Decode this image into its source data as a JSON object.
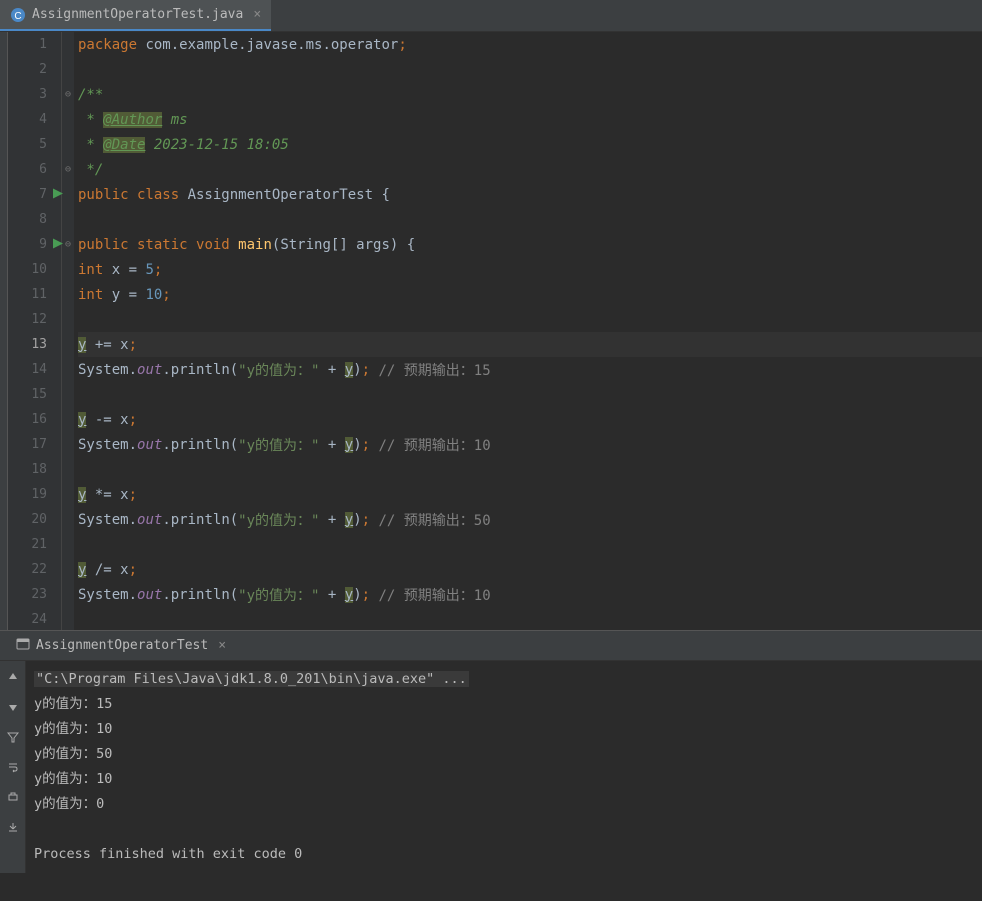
{
  "tab": {
    "name": "AssignmentOperatorTest.java"
  },
  "gutter": {
    "lines": [
      "1",
      "2",
      "3",
      "4",
      "5",
      "6",
      "7",
      "8",
      "9",
      "10",
      "11",
      "12",
      "13",
      "14",
      "15",
      "16",
      "17",
      "18",
      "19",
      "20",
      "21",
      "22",
      "23",
      "24"
    ],
    "currentLine": 13,
    "playLines": [
      7,
      9
    ]
  },
  "code": {
    "l1": {
      "kw1": "package ",
      "pkg": "com.example.javase.ms.operator",
      "semi": ";"
    },
    "l3": "/**",
    "l4": {
      "pre": " * ",
      "tag": "@Author",
      "rest": " ms"
    },
    "l5": {
      "pre": " * ",
      "tag": "@Date",
      "rest": " 2023-12-15 18:05"
    },
    "l6": " */",
    "l7": {
      "kw1": "public class ",
      "name": "AssignmentOperatorTest ",
      "brace": "{"
    },
    "l9": {
      "kw1": "public static ",
      "kw2": "void ",
      "fn": "main",
      "args": "(String[] args) {"
    },
    "l10": {
      "kw": "int ",
      "var": "x = ",
      "num": "5",
      "semi": ";"
    },
    "l11": {
      "kw": "int ",
      "var": "y = ",
      "num": "10",
      "semi": ";"
    },
    "l13": {
      "var": "y",
      "op": " += x",
      "semi": ";"
    },
    "l14": {
      "sys": "System.",
      "out": "out",
      "dot": ".println(",
      "str": "\"y的值为：\"",
      "plus": " + ",
      "y": "y",
      "close": ")",
      "semi": ";",
      "cmt": " // 预期输出：15"
    },
    "l16": {
      "var": "y",
      "op": " -= x",
      "semi": ";"
    },
    "l17": {
      "sys": "System.",
      "out": "out",
      "dot": ".println(",
      "str": "\"y的值为：\"",
      "plus": " + ",
      "y": "y",
      "close": ")",
      "semi": ";",
      "cmt": " // 预期输出：10"
    },
    "l19": {
      "var": "y",
      "op": " *= x",
      "semi": ";"
    },
    "l20": {
      "sys": "System.",
      "out": "out",
      "dot": ".println(",
      "str": "\"y的值为：\"",
      "plus": " + ",
      "y": "y",
      "close": ")",
      "semi": ";",
      "cmt": " // 预期输出：50"
    },
    "l22": {
      "var": "y",
      "op": " /= x",
      "semi": ";"
    },
    "l23": {
      "sys": "System.",
      "out": "out",
      "dot": ".println(",
      "str": "\"y的值为：\"",
      "plus": " + ",
      "y": "y",
      "close": ")",
      "semi": ";",
      "cmt": " // 预期输出：10"
    }
  },
  "runTab": {
    "name": "AssignmentOperatorTest"
  },
  "console": {
    "cmd": "\"C:\\Program Files\\Java\\jdk1.8.0_201\\bin\\java.exe\" ...",
    "l1": "y的值为：15",
    "l2": "y的值为：10",
    "l3": "y的值为：50",
    "l4": "y的值为：10",
    "l5": "y的值为：0",
    "exit": "Process finished with exit code 0"
  }
}
